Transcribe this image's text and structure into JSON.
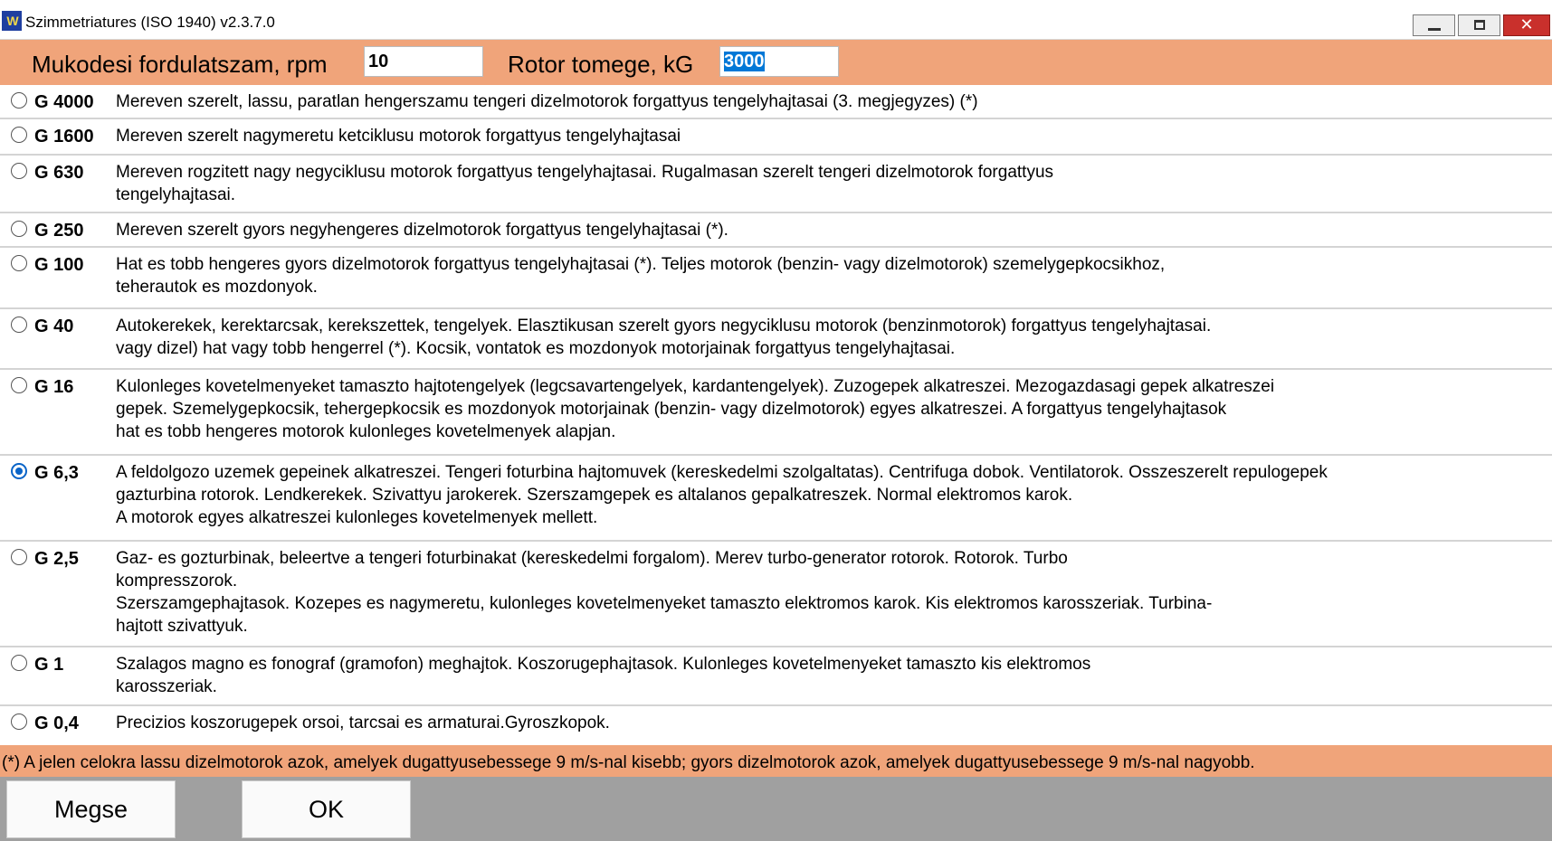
{
  "window": {
    "title": "Szimmetriatures (ISO 1940) v2.3.7.0",
    "icon": "app-logo-icon",
    "icon_text": "W"
  },
  "header": {
    "rpm_label": "Mukodesi fordulatszam, rpm",
    "rpm_value": "10",
    "mass_label": "Rotor tomege, kG",
    "mass_value": "3000"
  },
  "grades": [
    {
      "grade": "G 4000",
      "selected": false,
      "description": "Mereven szerelt, lassu, paratlan hengerszamu tengeri dizelmotorok forgattyus tengelyhajtasai (3. megjegyzes) (*)"
    },
    {
      "grade": "G 1600",
      "selected": false,
      "description": "Mereven szerelt nagymeretu ketciklusu motorok forgattyus tengelyhajtasai"
    },
    {
      "grade": "G 630",
      "selected": false,
      "description": "Mereven rogzitett nagy negyciklusu motorok forgattyus tengelyhajtasai. Rugalmasan szerelt tengeri dizelmotorok forgattyus\ntengelyhajtasai."
    },
    {
      "grade": "G 250",
      "selected": false,
      "description": "Mereven szerelt gyors negyhengeres dizelmotorok forgattyus tengelyhajtasai (*)."
    },
    {
      "grade": "G 100",
      "selected": false,
      "description": "Hat es tobb hengeres gyors dizelmotorok forgattyus tengelyhajtasai (*). Teljes motorok (benzin- vagy dizelmotorok) szemelygepkocsikhoz,\nteherautok es mozdonyok."
    },
    {
      "grade": "G 40",
      "selected": false,
      "description": "Autokerekek, kerektarcsak, kerekszettek, tengelyek. Elasztikusan szerelt gyors negyciklusu motorok (benzinmotorok) forgattyus tengelyhajtasai.\nvagy dizel) hat vagy tobb hengerrel (*). Kocsik, vontatok es mozdonyok motorjainak forgattyus tengelyhajtasai."
    },
    {
      "grade": "G 16",
      "selected": false,
      "description": "Kulonleges kovetelmenyeket tamaszto hajtotengelyek (legcsavartengelyek, kardantengelyek). Zuzogepek alkatreszei. Mezogazdasagi gepek alkatreszei\ngepek. Szemelygepkocsik, tehergepkocsik es mozdonyok motorjainak (benzin- vagy dizelmotorok) egyes alkatreszei. A forgattyus tengelyhajtasok\nhat es tobb hengeres motorok kulonleges kovetelmenyek alapjan."
    },
    {
      "grade": "G 6,3",
      "selected": true,
      "description": " A feldolgozo uzemek gepeinek alkatreszei. Tengeri foturbina hajtomuvek (kereskedelmi szolgaltatas). Centrifuga dobok. Ventilatorok. Osszeszerelt repulogepek\ngazturbina rotorok. Lendkerekek. Szivattyu jarokerek. Szerszamgepek es altalanos gepalkatreszek. Normal elektromos karok.\nA motorok egyes alkatreszei kulonleges kovetelmenyek mellett."
    },
    {
      "grade": "G 2,5",
      "selected": false,
      "description": "Gaz- es gozturbinak, beleertve a tengeri foturbinakat (kereskedelmi forgalom). Merev turbo-generator rotorok. Rotorok. Turbo\nkompresszorok.\nSzerszamgephajtasok. Kozepes es nagymeretu, kulonleges kovetelmenyeket tamaszto elektromos karok. Kis elektromos karosszeriak. Turbina-\nhajtott szivattyuk."
    },
    {
      "grade": "G 1",
      "selected": false,
      "description": "Szalagos magno es fonograf (gramofon) meghajtok. Koszorugephajtasok. Kulonleges kovetelmenyeket tamaszto kis elektromos\nkarosszeriak."
    },
    {
      "grade": "G 0,4",
      "selected": false,
      "description": "Precizios koszorugepek orsoi, tarcsai es armaturai.Gyroszkopok."
    }
  ],
  "footnote": "(*) A jelen celokra lassu dizelmotorok azok, amelyek dugattyusebessege 9 m/s-nal kisebb; gyors dizelmotorok azok, amelyek dugattyusebessege 9 m/s-nal nagyobb.",
  "buttons": {
    "cancel": "Megse",
    "ok": "OK"
  }
}
